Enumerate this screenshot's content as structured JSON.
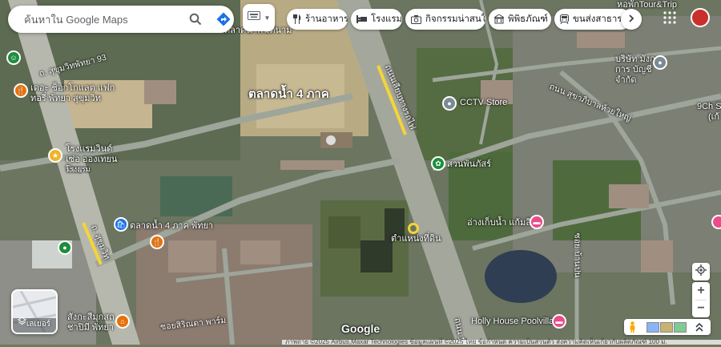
{
  "search": {
    "placeholder": "ค้นหาใน Google Maps"
  },
  "chips": [
    {
      "label": "ร้านอาหาร",
      "icon": "restaurant-icon"
    },
    {
      "label": "โรงแรม",
      "icon": "hotel-icon"
    },
    {
      "label": "กิจกรรมน่าสนใจ",
      "icon": "camera-icon"
    },
    {
      "label": "พิพิธภัณฑ์",
      "icon": "museum-icon"
    },
    {
      "label": "ขนส่งสาธารณะ",
      "icon": "transit-icon"
    }
  ],
  "places": {
    "floating_market": "ตลาดน้ำ 4 ภาค",
    "floating_market_pattaya": "ตลาดน้ำ 4 ภาค พัทยา",
    "cctv_store": "CCTV Store",
    "suan_phan": "สวนพันภัสร์",
    "reservoir": "อ่างเก็บน้ำ แก้มลิง",
    "holly_house": "Holly House Poolvilla",
    "location_label": "ตำแหน่งที่ดิน",
    "d_chocolate": "เดอะ ช็อกโกแลต แฟกทอรี่ พัทยา สุขุมวิท",
    "windsor": "โรงแรมวินด์เซ่อ อองเทยน พัทยา",
    "windsor_sub": "โรงแรม",
    "tour_trip": "หอพักTour&Trip",
    "company": "บริษัท มังกร การ บัญชี จำกัด",
    "stadium": "สังกะสีมุกสถ ชาปิมี พัทยา",
    "nine_ch": "9Ch Sp",
    "nine_ch_sub": "(เก้",
    "road_sukhumvit_93": "ถ. สุขุมวิทพัทยา 93",
    "road_sukhumvit": "ถ. สุขุมวิท",
    "road_rail": "ถนนเลียบทางรถไฟ",
    "road_huay_yai": "ถนน สุขาภิบาลห้วยใหญ่",
    "road_siri": "ซอยสิริณดา พาร์ม",
    "road_ban": "ซอย บ้านปน",
    "road_1": "ถนน 1",
    "top_partial": "ตลาดน้ำพิฆตีนาม"
  },
  "controls": {
    "zoom_in": "+",
    "zoom_out": "−",
    "layers_label": "เลเยอร์"
  },
  "footer": {
    "logo": "Google",
    "attribution": "ภาพถ่าย ©2025 Airbus,Maxar Technologies ข้อมูลแผนที่ ©2025   ไทย   ข้อกำหนด   ความเป็นส่วนตัว   ส่งความคิดเห็นเกี่ยวกับผลิตภัณฑ์   100 ม."
  },
  "colors": {
    "road": "#9ea59a",
    "highway": "#b7bdb3",
    "pin_red": "#ea4335",
    "water": "#3b4c5e"
  }
}
